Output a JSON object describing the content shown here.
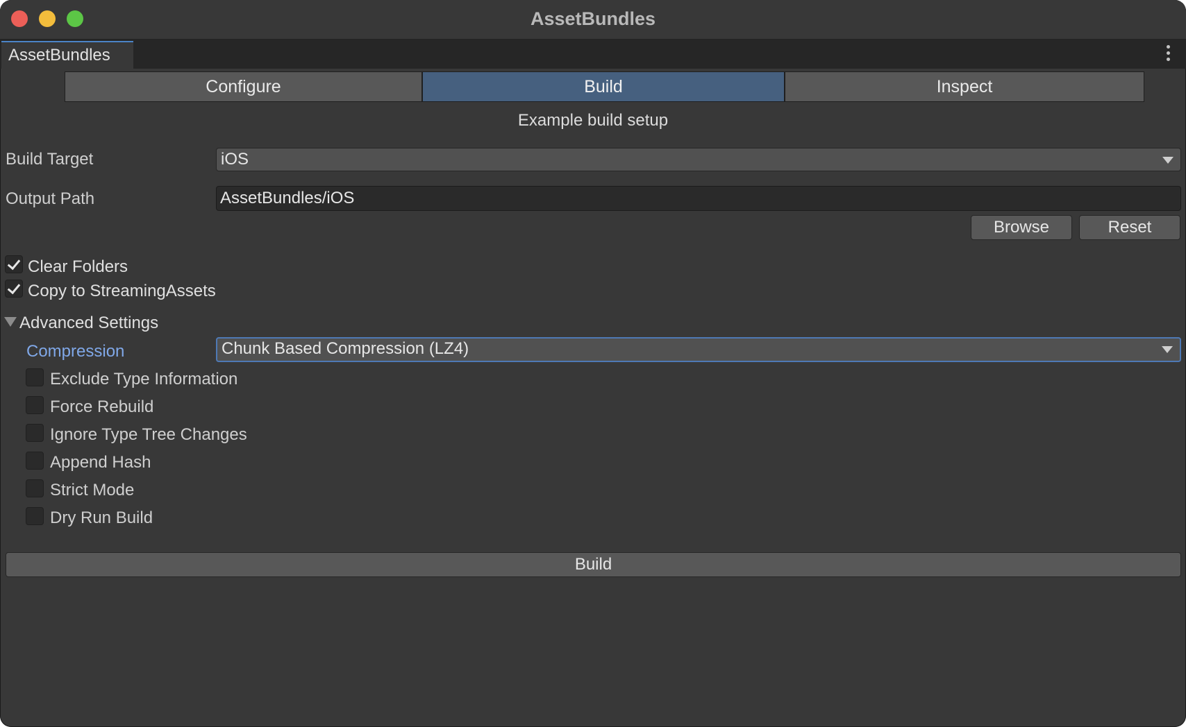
{
  "window": {
    "title": "AssetBundles"
  },
  "tab": {
    "label": "AssetBundles"
  },
  "mode_tabs": [
    {
      "label": "Configure",
      "active": false
    },
    {
      "label": "Build",
      "active": true
    },
    {
      "label": "Inspect",
      "active": false
    }
  ],
  "subtitle": "Example build setup",
  "build_target": {
    "label": "Build Target",
    "value": "iOS"
  },
  "output_path": {
    "label": "Output Path",
    "value": "AssetBundles/iOS"
  },
  "buttons": {
    "browse": "Browse",
    "reset": "Reset",
    "build": "Build"
  },
  "options": [
    {
      "label": "Clear Folders",
      "checked": true
    },
    {
      "label": "Copy to StreamingAssets",
      "checked": true
    }
  ],
  "advanced": {
    "label": "Advanced Settings",
    "expanded": true,
    "compression": {
      "label": "Compression",
      "value": "Chunk Based Compression (LZ4)"
    },
    "options": [
      {
        "label": "Exclude Type Information",
        "checked": false
      },
      {
        "label": "Force Rebuild",
        "checked": false
      },
      {
        "label": "Ignore Type Tree Changes",
        "checked": false
      },
      {
        "label": "Append Hash",
        "checked": false
      },
      {
        "label": "Strict Mode",
        "checked": false
      },
      {
        "label": "Dry Run Build",
        "checked": false
      }
    ]
  },
  "colors": {
    "background": "#383838",
    "active_tab": "#46607f",
    "accent_blue": "#80a8e8",
    "close": "#ec5f58",
    "minimize": "#f3bd3c",
    "maximize": "#5cc646"
  },
  "icons": {
    "close": "close-button",
    "minimize": "minimize-button",
    "maximize": "maximize-button",
    "menu": "kebab-menu-icon",
    "dropdown": "chevron-down-icon",
    "foldout": "triangle-down-icon",
    "check": "checkmark-icon"
  }
}
